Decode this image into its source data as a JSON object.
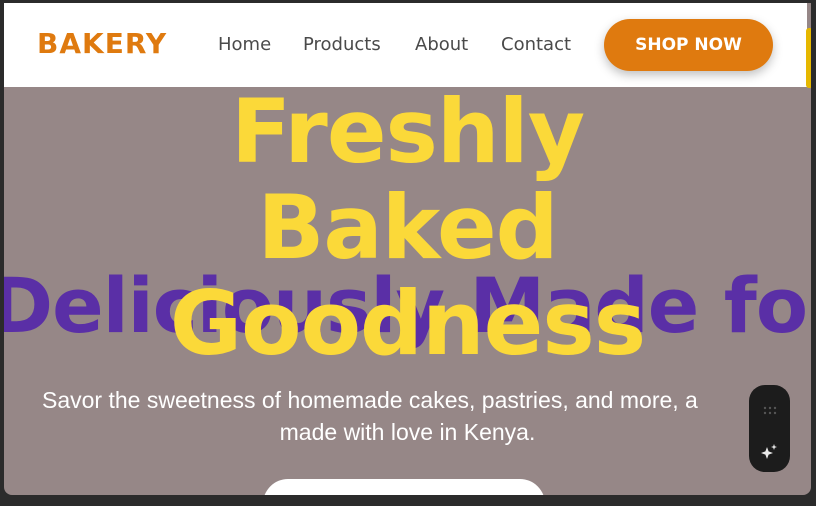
{
  "brand": "BAKERY",
  "nav": {
    "links": [
      "Home",
      "Products",
      "About",
      "Contact"
    ],
    "cta_label": "SHOP NOW"
  },
  "hero": {
    "title_lines": [
      "Freshly",
      "Baked",
      "Goodness"
    ],
    "background_text": "Deliciously Made for You",
    "subtitle_line1": "Savor the sweetness of homemade cakes, pastries, and more, a",
    "subtitle_line2": "made with love in Kenya."
  },
  "colors": {
    "brand_orange": "#df7a0f",
    "title_yellow": "#fbd939",
    "bg_text_purple": "#5a2fa6",
    "hero_bg": "#968787"
  },
  "widget": {
    "icons": [
      "drag-grid-icon",
      "sparkle-icon"
    ]
  }
}
